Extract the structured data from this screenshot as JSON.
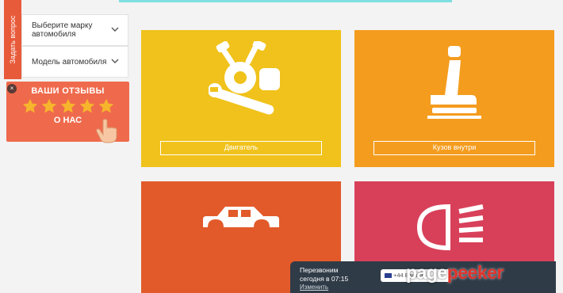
{
  "sidebar": {
    "ask_tab_label": "Задать вопрос",
    "brand_select": {
      "label": "Выберите марку автомобиля"
    },
    "model_select": {
      "label": "Модель автомобиля"
    },
    "reviews": {
      "title": "ВАШИ ОТЗЫВЫ",
      "about": "О НАС",
      "stars": 5
    }
  },
  "tiles": [
    {
      "label": "Двигатель",
      "icon": "engine-wrench-icon",
      "color": "#f0c21b"
    },
    {
      "label": "Кузов внутри",
      "icon": "car-seat-icon",
      "color": "#f49c1e"
    },
    {
      "label": "",
      "icon": "car-body-icon",
      "color": "#e25a2a"
    },
    {
      "label": "",
      "icon": "headlight-icon",
      "color": "#d84059"
    }
  ],
  "callback": {
    "text_line1": "Перезвоним",
    "text_line2": "сегодня в 07:15",
    "link": "Изменить",
    "phone_placeholder": "+44 Ваш те"
  },
  "watermark": {
    "part1": "page",
    "part2": "peeker"
  },
  "colors": {
    "accent": "#7fdfe0",
    "reviews_bg": "#ef6a4c",
    "star": "#f7b52c"
  }
}
